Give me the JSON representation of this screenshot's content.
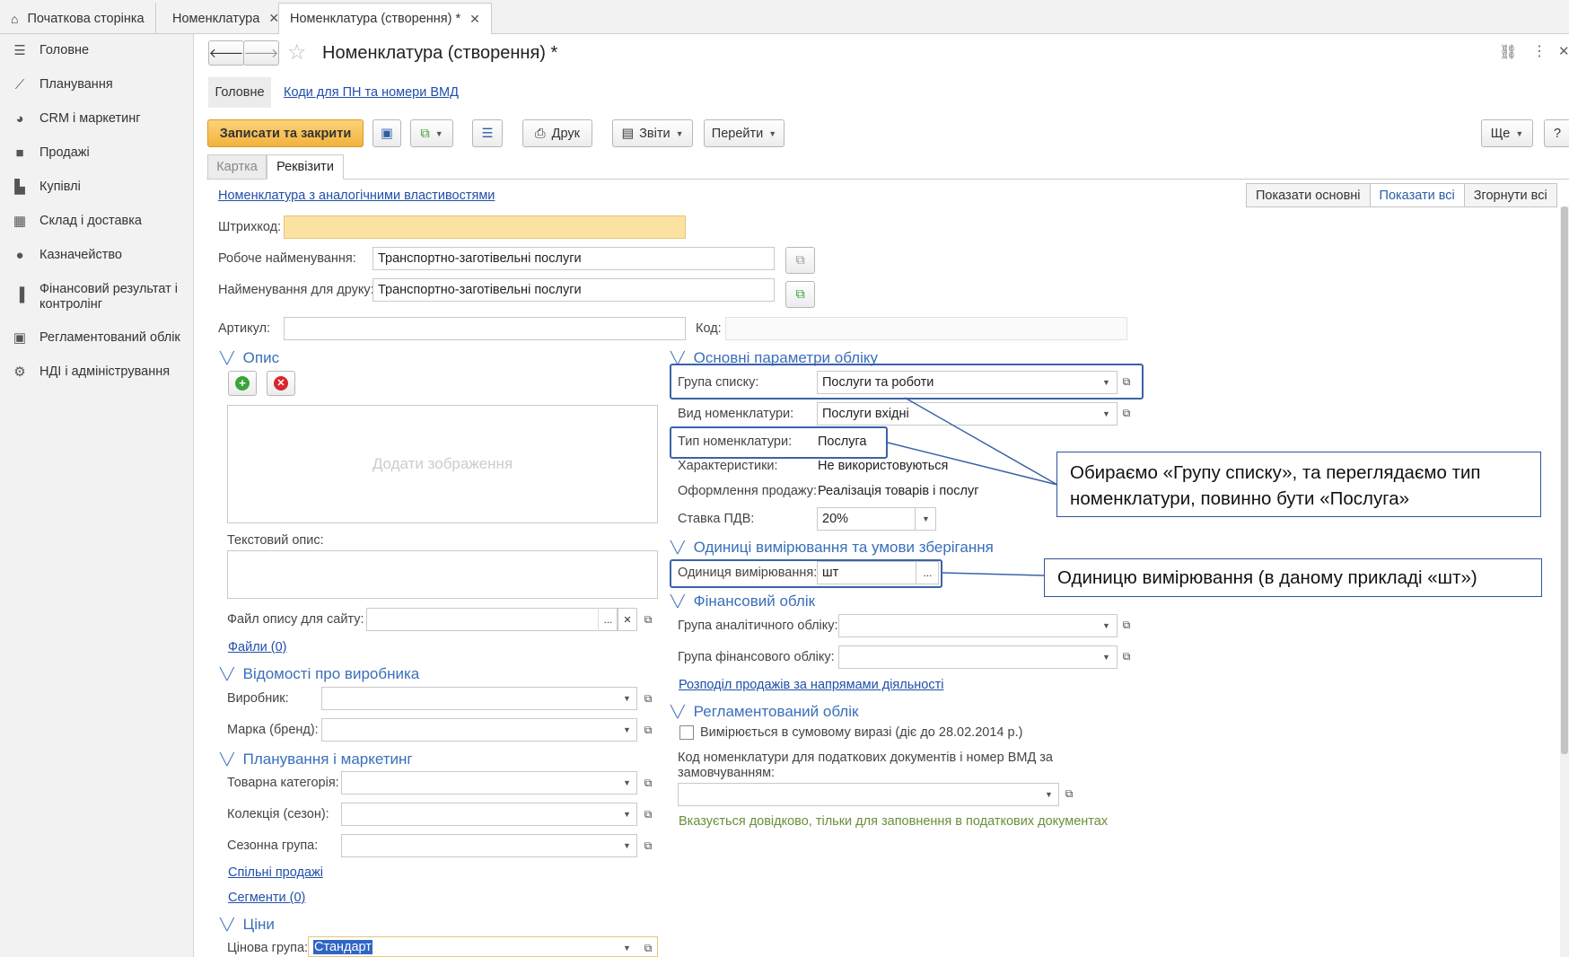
{
  "tabs": [
    {
      "label": "Початкова сторінка"
    },
    {
      "label": "Номенклатура"
    },
    {
      "label": "Номенклатура (створення) *"
    }
  ],
  "sidebar": {
    "items": [
      {
        "label": "Головне",
        "icon": "menu-icon"
      },
      {
        "label": "Планування",
        "icon": "chart-line-icon"
      },
      {
        "label": "CRM і маркетинг",
        "icon": "pie-chart-icon"
      },
      {
        "label": "Продажі",
        "icon": "bag-icon"
      },
      {
        "label": "Купівлі",
        "icon": "cart-icon"
      },
      {
        "label": "Склад і доставка",
        "icon": "grid-icon"
      },
      {
        "label": "Казначейство",
        "icon": "coin-icon"
      },
      {
        "label": "Фінансовий результат і контролінг",
        "icon": "bar-chart-icon"
      },
      {
        "label": "Регламентований облік",
        "icon": "calculator-icon"
      },
      {
        "label": "НДІ і адміністрування",
        "icon": "gear-icon"
      }
    ]
  },
  "header": {
    "title": "Номенклатура (створення) *",
    "subtab_main": "Головне",
    "subtab_link": "Коди для ПН та номери ВМД"
  },
  "toolbar": {
    "save_close": "Записати та закрити",
    "print": "Друк",
    "reports": "Звіти",
    "goto": "Перейти",
    "more": "Ще",
    "help": "?"
  },
  "form_tabs": {
    "card": "Картка",
    "requisites": "Реквізити"
  },
  "view_buttons": {
    "show_main": "Показати основні",
    "show_all": "Показати всі",
    "collapse_all": "Згорнути всі"
  },
  "top": {
    "analog_link": "Номенклатура з аналогічними властивостями",
    "barcode_label": "Штрихкод:",
    "barcode_value": "",
    "work_name_label": "Робоче найменування:",
    "work_name_value": "Транспортно-заготівельні послуги",
    "print_name_label": "Найменування для друку:",
    "print_name_value": "Транспортно-заготівельні послуги",
    "article_label": "Артикул:",
    "code_label": "Код:"
  },
  "left": {
    "desc_section": "Опис",
    "add_image": "Додати зображення",
    "text_desc_label": "Текстовий опис:",
    "site_file_label": "Файл опису для сайту:",
    "files_link": "Файли (0)",
    "producer_section": "Відомості про виробника",
    "producer_label": "Виробник:",
    "brand_label": "Марка (бренд):",
    "planning_section": "Планування і маркетинг",
    "category_label": "Товарна категорія:",
    "collection_label": "Колекція (сезон):",
    "season_group_label": "Сезонна група:",
    "joint_sales_link": "Спільні продажі",
    "segments_link": "Сегменти (0)",
    "prices_section": "Ціни",
    "price_group_label": "Цінова група:",
    "price_group_value": "Стандарт"
  },
  "right": {
    "accounting_section": "Основні параметри обліку",
    "list_group_label": "Група списку:",
    "list_group_value": "Послуги та роботи",
    "kind_label": "Вид номенклатури:",
    "kind_value": "Послуги вхідні",
    "type_label": "Тип номенклатури:",
    "type_value": "Послуга",
    "characteristics_label": "Характеристики:",
    "characteristics_value": "Не використовуються",
    "sale_label": "Оформлення продажу:",
    "sale_value": "Реалізація товарів і послуг",
    "vat_label": "Ставка ПДВ:",
    "vat_value": "20%",
    "units_section": "Одиниці вимірювання та умови зберігання",
    "unit_label": "Одиниця вимірювання:",
    "unit_value": "шт",
    "finance_section": "Фінансовий облік",
    "analytic_group_label": "Група аналітичного обліку:",
    "finance_group_label": "Група фінансового обліку:",
    "distribution_link": "Розподіл продажів за напрямами діяльності",
    "regulated_section": "Регламентований облік",
    "sum_checkbox_label": "Вимірюється в сумовому виразі (діє до 28.02.2014 р.)",
    "tax_code_label": "Код номенклатури для податкових документів і номер ВМД за замовчуванням:",
    "tax_hint": "Вказується довідково, тільки для заповнення в податкових документах"
  },
  "annotations": {
    "callout1": "Обираємо «Групу списку», та переглядаємо тип номенклатури, повинно бути «Послуга»",
    "callout2": "Одиницю вимірювання (в даному прикладі «шт»)"
  }
}
